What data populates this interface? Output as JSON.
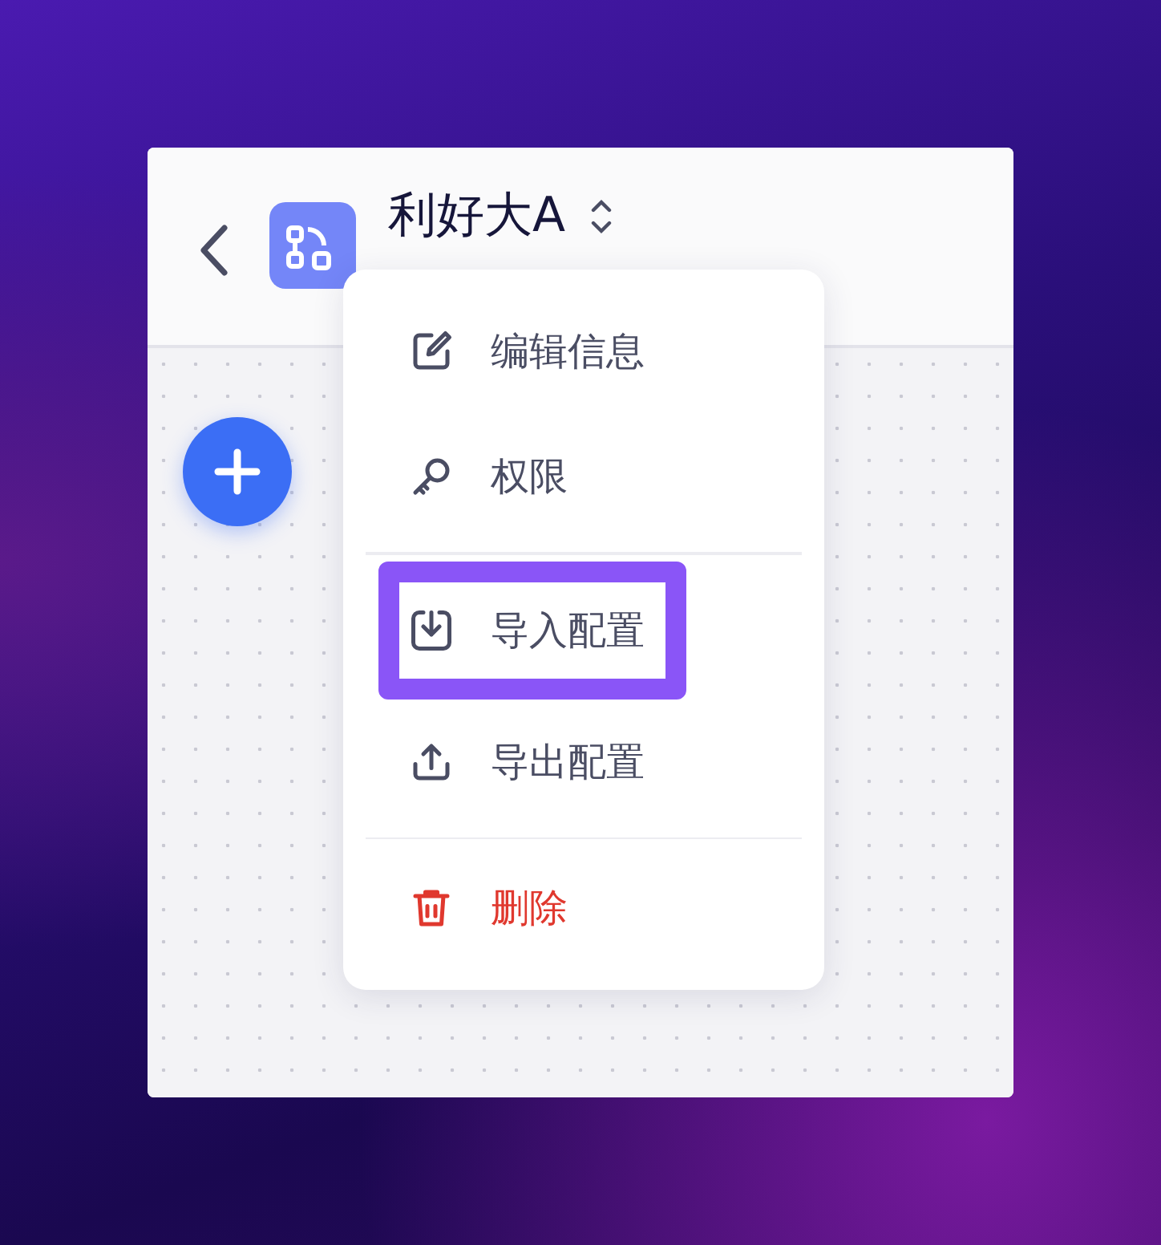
{
  "header": {
    "title": "利好大A"
  },
  "menu": {
    "groups": [
      [
        {
          "label": "编辑信息",
          "kind": "edit",
          "highlighted": false,
          "danger": false
        },
        {
          "label": "权限",
          "kind": "key",
          "highlighted": false,
          "danger": false
        }
      ],
      [
        {
          "label": "导入配置",
          "kind": "import",
          "highlighted": true,
          "danger": false
        },
        {
          "label": "导出配置",
          "kind": "export",
          "highlighted": false,
          "danger": false
        }
      ],
      [
        {
          "label": "删除",
          "kind": "trash",
          "highlighted": false,
          "danger": true
        }
      ]
    ]
  }
}
